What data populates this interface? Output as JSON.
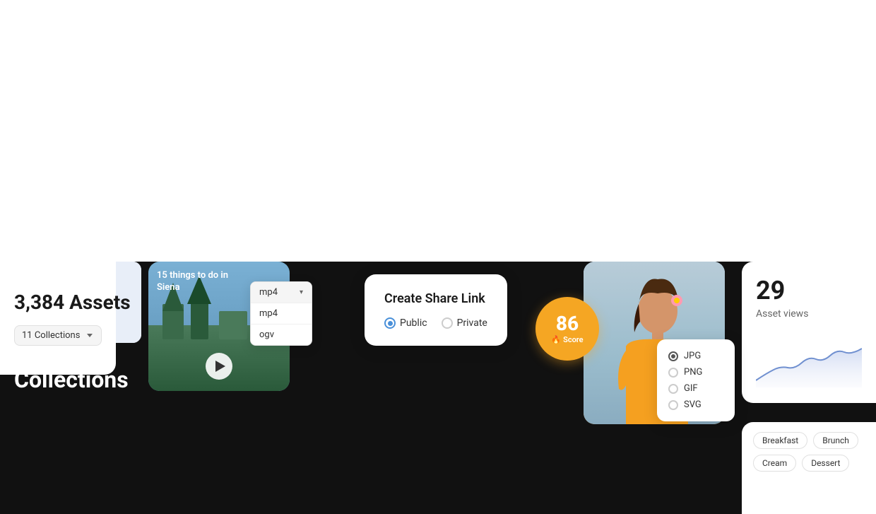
{
  "assets": {
    "count": "3,384 Assets",
    "collections_count": "11 Collections",
    "collections_label": "Collections"
  },
  "video_card": {
    "title": "15 things to do in Siena"
  },
  "format_dropdown": {
    "header": "mp4",
    "options": [
      "mp4",
      "ogv"
    ],
    "chevron_label": "▾"
  },
  "radio_formats": {
    "options": [
      "JPG",
      "PNG",
      "GIF",
      "SVG"
    ],
    "selected": "JPG"
  },
  "share_link": {
    "title": "Create Share Link",
    "options": [
      "Public",
      "Private"
    ],
    "selected": "Public"
  },
  "score": {
    "number": "86",
    "label": "Score"
  },
  "analytics": {
    "number": "29",
    "label": "Asset views"
  },
  "tags": {
    "row1": [
      "Breakfast",
      "Brunch"
    ],
    "row2": [
      "Cream",
      "Dessert"
    ]
  },
  "colors": {
    "accent_blue": "#4a90d9",
    "accent_orange": "#f5a623",
    "bg_dark": "#111111",
    "bg_white": "#ffffff",
    "text_dark": "#1a1a1a",
    "text_gray": "#666666"
  }
}
